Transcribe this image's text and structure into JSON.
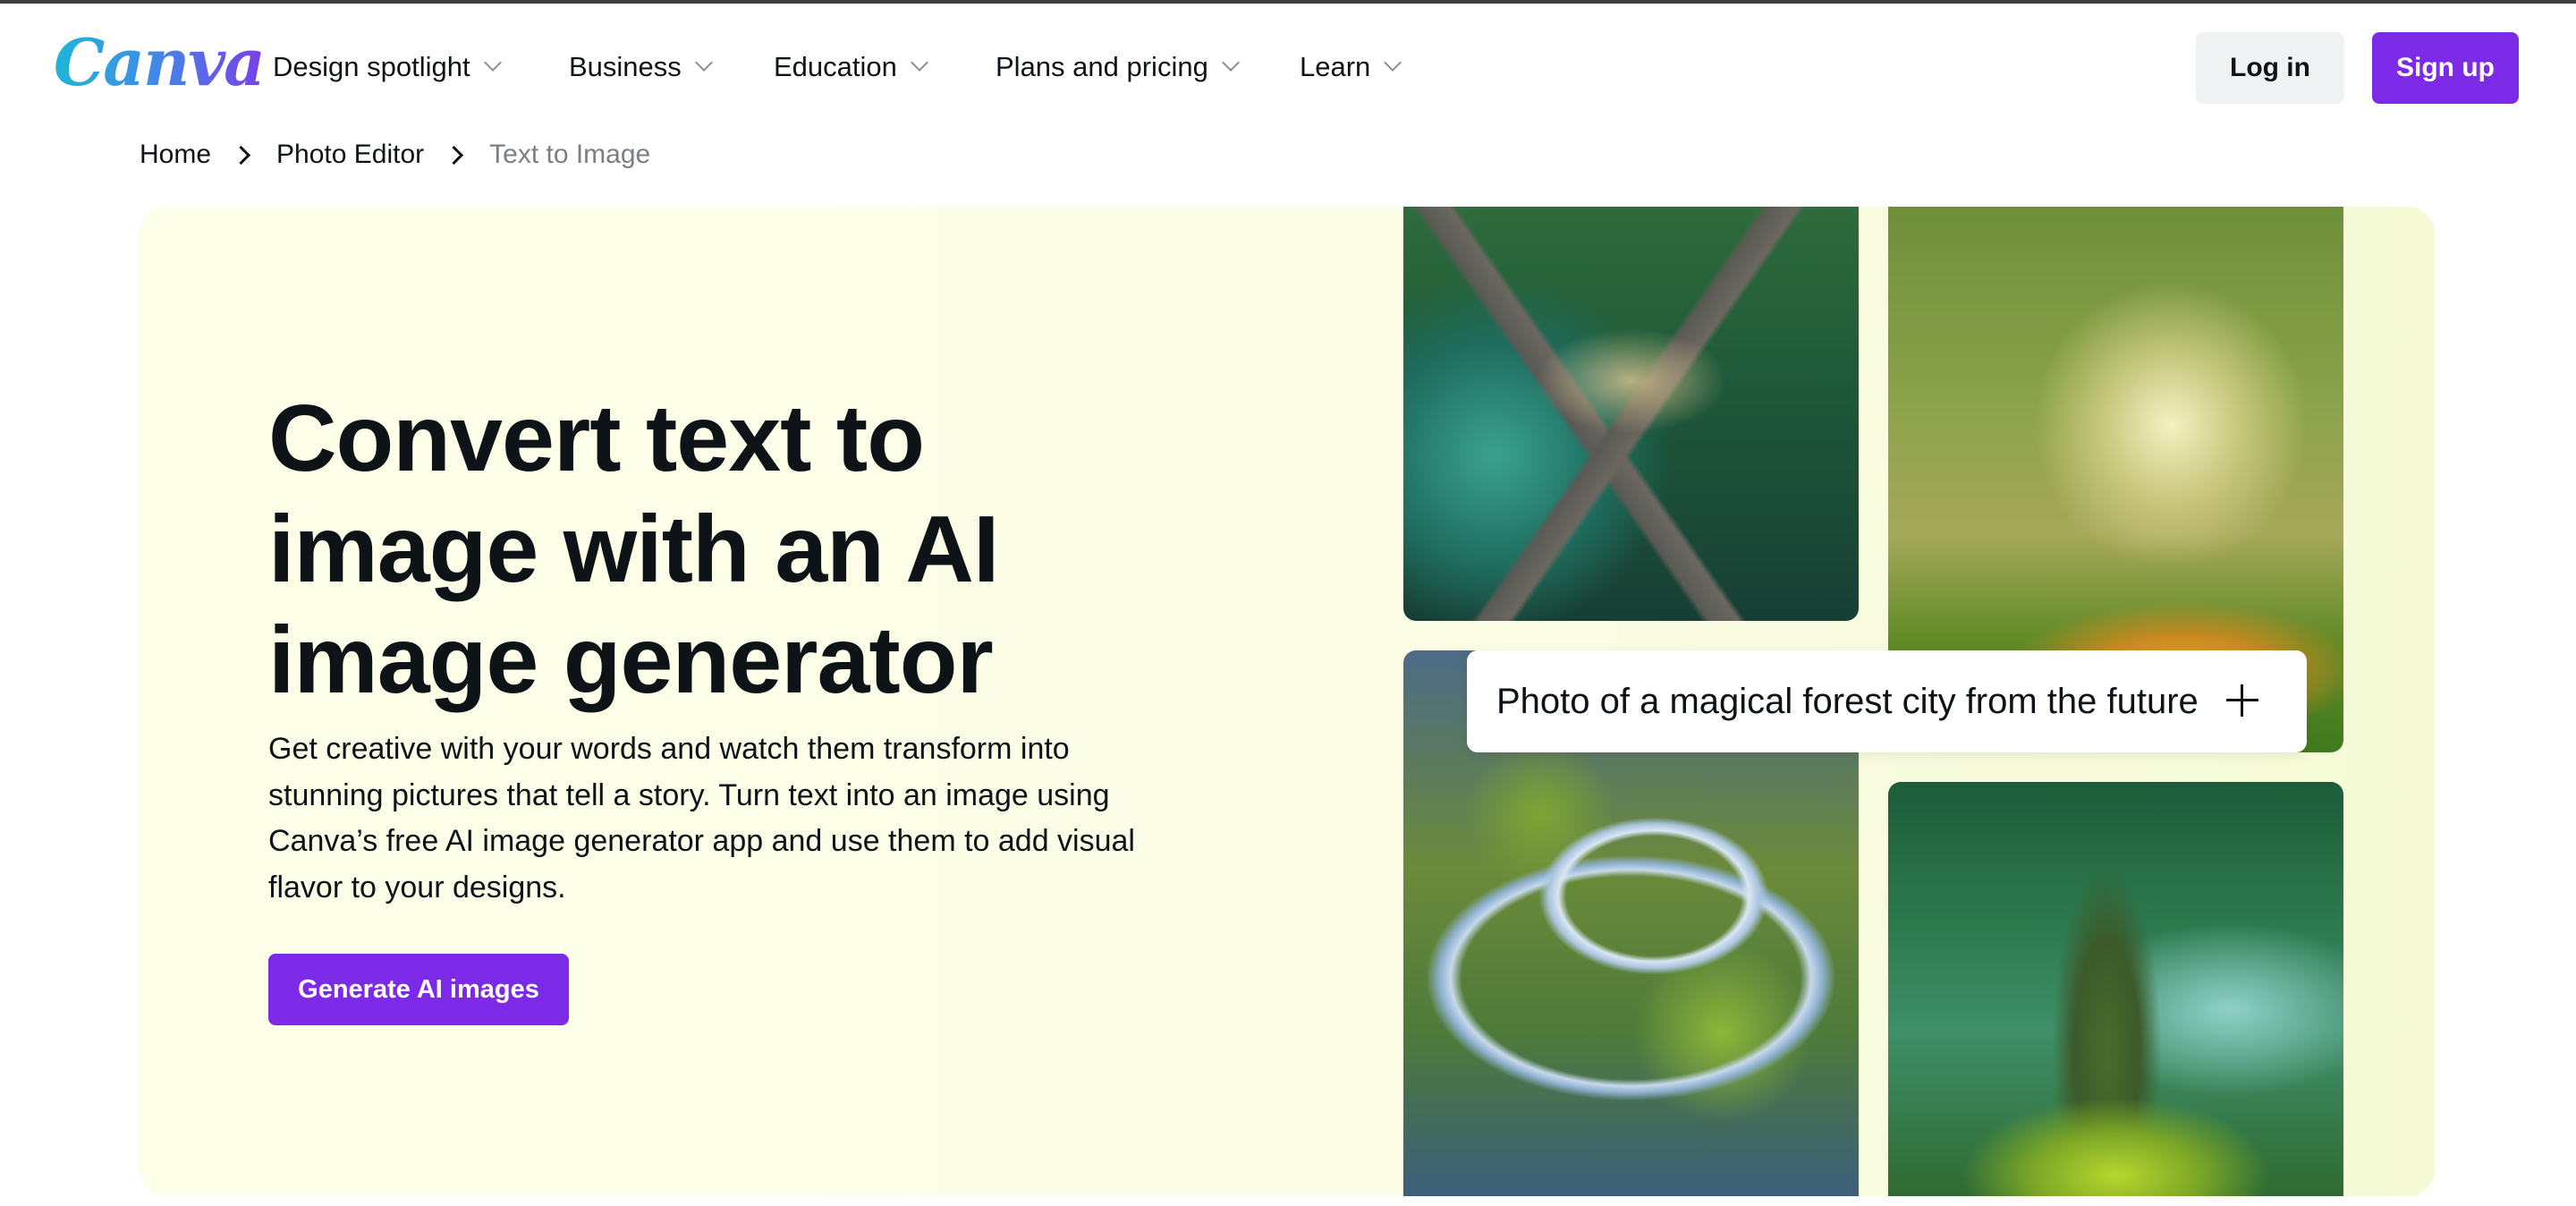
{
  "header": {
    "logo": "Canva",
    "nav": [
      {
        "label": "Design spotlight"
      },
      {
        "label": "Business"
      },
      {
        "label": "Education"
      },
      {
        "label": "Plans and pricing"
      },
      {
        "label": "Learn"
      }
    ],
    "login_label": "Log in",
    "signup_label": "Sign up"
  },
  "breadcrumb": [
    {
      "label": "Home"
    },
    {
      "label": "Photo Editor"
    },
    {
      "label": "Text to Image"
    }
  ],
  "hero": {
    "headline_lines": [
      "Convert text to",
      "image with an AI",
      "image generator"
    ],
    "description_lines": [
      "Get creative with your words and watch them transform into",
      "stunning pictures that tell a story. Turn text into an image using",
      "Canva’s free AI image generator app and use them to add visual",
      "flavor to your designs."
    ],
    "cta_label": "Generate AI images",
    "prompt_text": "Photo of a magical forest city from the future",
    "images": [
      {
        "icon": "image-forest-city-aerial"
      },
      {
        "icon": "image-enchanted-forest-glow"
      },
      {
        "icon": "image-forest-city-roads"
      },
      {
        "icon": "image-giant-tree-forest"
      }
    ]
  },
  "colors": {
    "brand_purple": "#7d2ae8",
    "hero_background": "#fbfde6",
    "login_background": "#f0f2f4"
  }
}
